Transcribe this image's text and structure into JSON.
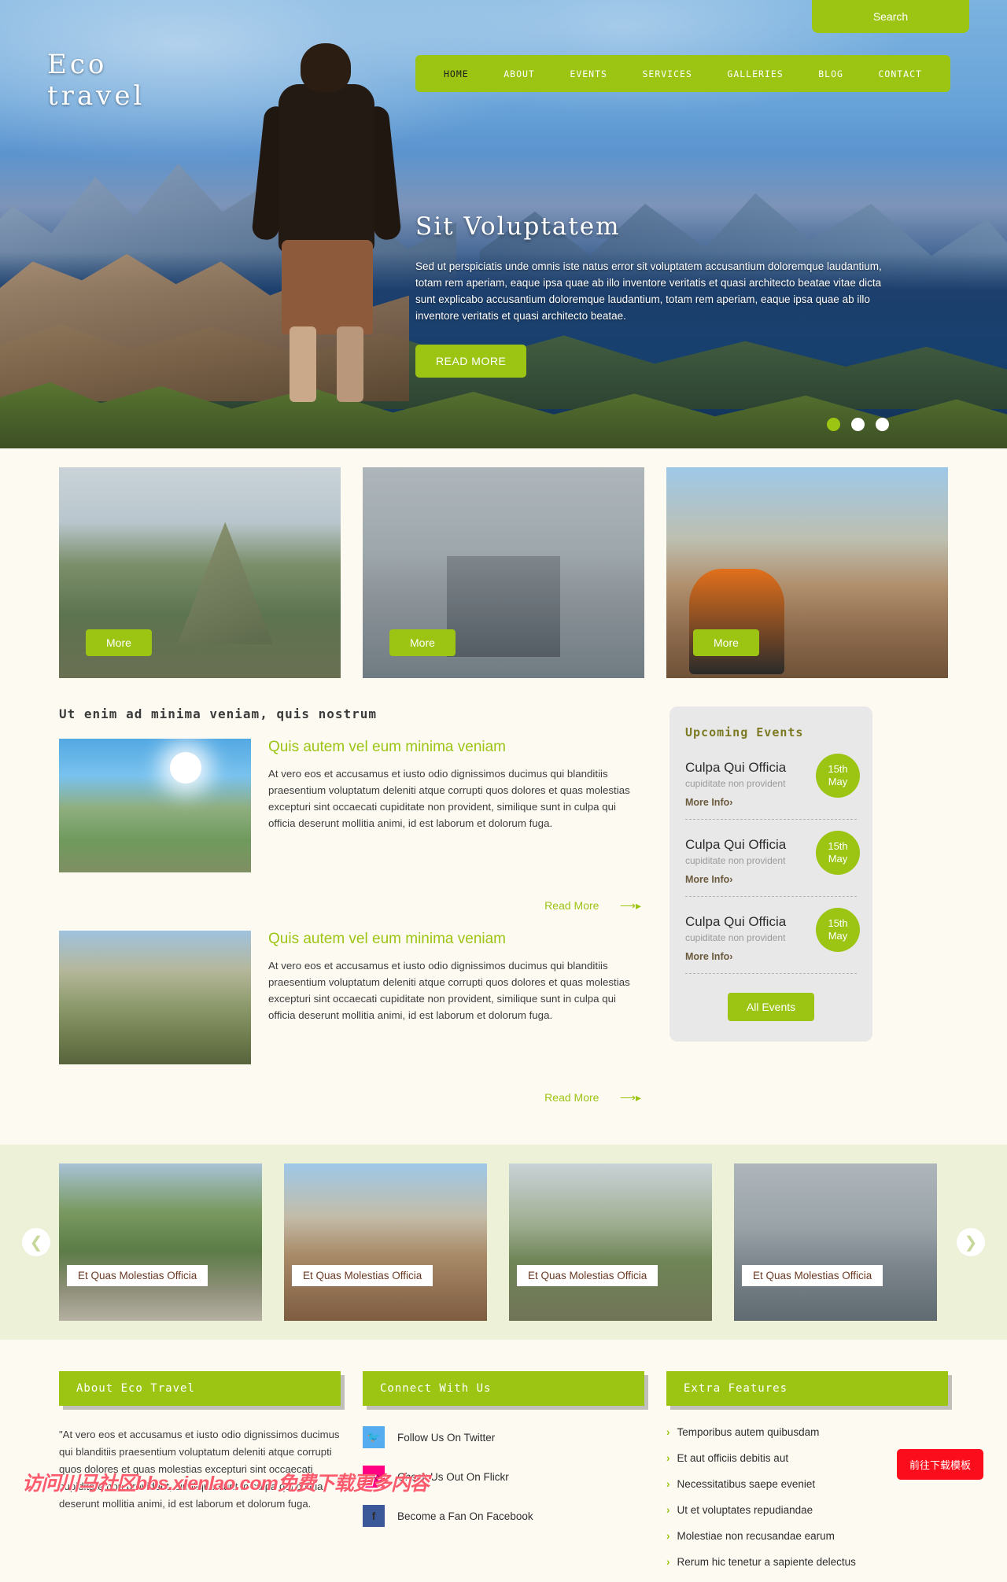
{
  "brand": {
    "line1": "Eco",
    "line2": "travel",
    "accent": "#9cc413"
  },
  "header": {
    "search_label": "Search",
    "nav": [
      {
        "label": "HOME",
        "active": true
      },
      {
        "label": "ABOUT",
        "active": false
      },
      {
        "label": "EVENTS",
        "active": false
      },
      {
        "label": "SERVICES",
        "active": false
      },
      {
        "label": "GALLERIES",
        "active": false
      },
      {
        "label": "BLOG",
        "active": false
      },
      {
        "label": "CONTACT",
        "active": false
      }
    ]
  },
  "hero": {
    "title": "Sit Voluptatem",
    "body": "Sed ut perspiciatis unde omnis iste natus error sit voluptatem accusantium doloremque laudantium, totam rem aperiam, eaque ipsa quae ab illo inventore veritatis et quasi architecto beatae vitae dicta sunt explicabo accusantium doloremque laudantium, totam rem aperiam, eaque ipsa quae ab illo inventore veritatis et quasi architecto beatae.",
    "cta": "READ MORE",
    "slides": 3,
    "active_slide": 1
  },
  "cards": [
    {
      "more_label": "More",
      "image": "machu-picchu-photo"
    },
    {
      "more_label": "More",
      "image": "brooklyn-bridge-photo"
    },
    {
      "more_label": "More",
      "image": "grand-canyon-hiker-photo"
    }
  ],
  "main": {
    "section_title": "Ut enim ad minima veniam, quis nostrum",
    "posts": [
      {
        "title": "Quis autem vel eum minima veniam",
        "body": "At vero eos et accusamus et iusto odio dignissimos ducimus qui blanditiis praesentium voluptatum deleniti atque corrupti quos dolores et quas molestias excepturi sint occaecati cupiditate non provident, similique sunt in culpa qui officia deserunt mollitia animi, id est laborum et dolorum fuga.",
        "read_more": "Read More",
        "image": "hiker-with-map-photo"
      },
      {
        "title": "Quis autem vel eum minima veniam",
        "body": "At vero eos et accusamus et iusto odio dignissimos ducimus qui blanditiis praesentium voluptatum deleniti atque corrupti quos dolores et quas molestias excepturi sint occaecati cupiditate non provident, similique sunt in culpa qui officia deserunt mollitia animi, id est laborum et dolorum fuga.",
        "read_more": "Read More",
        "image": "mountain-ridge-trail-photo"
      }
    ]
  },
  "events": {
    "heading": "Upcoming Events",
    "items": [
      {
        "title": "Culpa Qui Officia",
        "subtitle": "cupiditate non provident",
        "link": "More Info",
        "day": "15th",
        "month": "May"
      },
      {
        "title": "Culpa Qui Officia",
        "subtitle": "cupiditate non provident",
        "link": "More Info",
        "day": "15th",
        "month": "May"
      },
      {
        "title": "Culpa Qui Officia",
        "subtitle": "cupiditate non provident",
        "link": "More Info",
        "day": "15th",
        "month": "May"
      }
    ],
    "all_events": "All Events"
  },
  "gallery": {
    "prev_icon": "chevron-left-icon",
    "next_icon": "chevron-right-icon",
    "items": [
      {
        "caption": "Et Quas Molestias Officia",
        "image": "hiker-stream-photo"
      },
      {
        "caption": "Et Quas Molestias Officia",
        "image": "canyon-hiker-photo"
      },
      {
        "caption": "Et Quas Molestias Officia",
        "image": "machu-picchu-group-photo"
      },
      {
        "caption": "Et Quas Molestias Officia",
        "image": "bridge-lamp-photo"
      }
    ]
  },
  "footer": {
    "about": {
      "heading": "About Eco Travel",
      "body": "\"At vero eos et accusamus et iusto odio dignissimos ducimus qui blanditiis praesentium voluptatum deleniti atque corrupti quos dolores et quas molestias excepturi sint occaecati cupiditate non provident, similique sunt in culpa qui officia deserunt mollitia animi, id est laborum et dolorum fuga."
    },
    "connect": {
      "heading": "Connect With Us",
      "links": [
        {
          "label": "Follow Us On Twitter",
          "icon": "twitter-icon",
          "glyph": "🐦"
        },
        {
          "label": "Check Us Out On Flickr",
          "icon": "flickr-icon",
          "glyph": "●○"
        },
        {
          "label": "Become a Fan On Facebook",
          "icon": "facebook-icon",
          "glyph": "f"
        }
      ]
    },
    "extra": {
      "heading": "Extra Features",
      "items": [
        "Temporibus autem quibusdam",
        "Et aut officiis debitis aut",
        "Necessitatibus saepe eveniet",
        "Ut et voluptates repudiandae",
        "Molestiae non recusandae earum",
        "Rerum hic tenetur a sapiente delectus"
      ]
    }
  },
  "overlay": {
    "download_button": "前往下载模板",
    "watermark": "访问川马社区bbs.xienlao.com免费下载更多内容"
  }
}
